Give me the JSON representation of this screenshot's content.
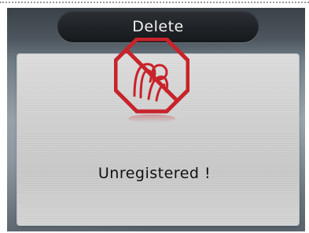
{
  "header": {
    "title": "Delete"
  },
  "dialog": {
    "message": "Unregistered !",
    "icon": "no-fingerprint-icon",
    "accent_color": "#c8232a"
  }
}
